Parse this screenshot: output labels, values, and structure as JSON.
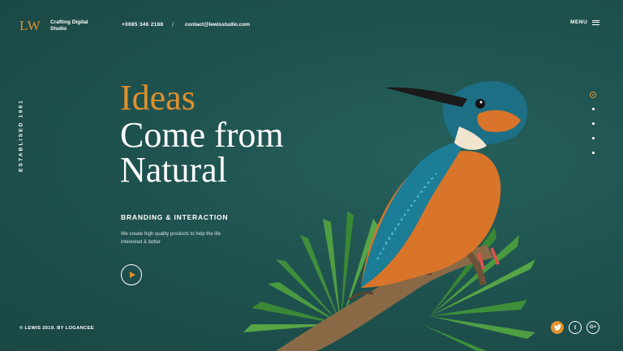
{
  "header": {
    "logo": "LW",
    "tagline": "Crafting Digital Studio",
    "phone": "+0085 346 2188",
    "separator": "/",
    "email": "contact@lewisstudio.com",
    "menu_label": "MENU"
  },
  "sidebar": {
    "established": "ESTABLISED 1981"
  },
  "hero": {
    "line1": "Ideas",
    "line2": "Come from",
    "line3": "Natural",
    "subheading": "BRANDING & INTERACTION",
    "description": "We create high quality products to help the life interested & better"
  },
  "footer": {
    "copyright": "© LEWIS 2019. BY LOGANCEE",
    "social": [
      "twitter-icon",
      "facebook-icon",
      "google-plus-icon"
    ]
  },
  "colors": {
    "background": "#1f5350",
    "accent": "#e0902c",
    "text": "#ffffff"
  }
}
